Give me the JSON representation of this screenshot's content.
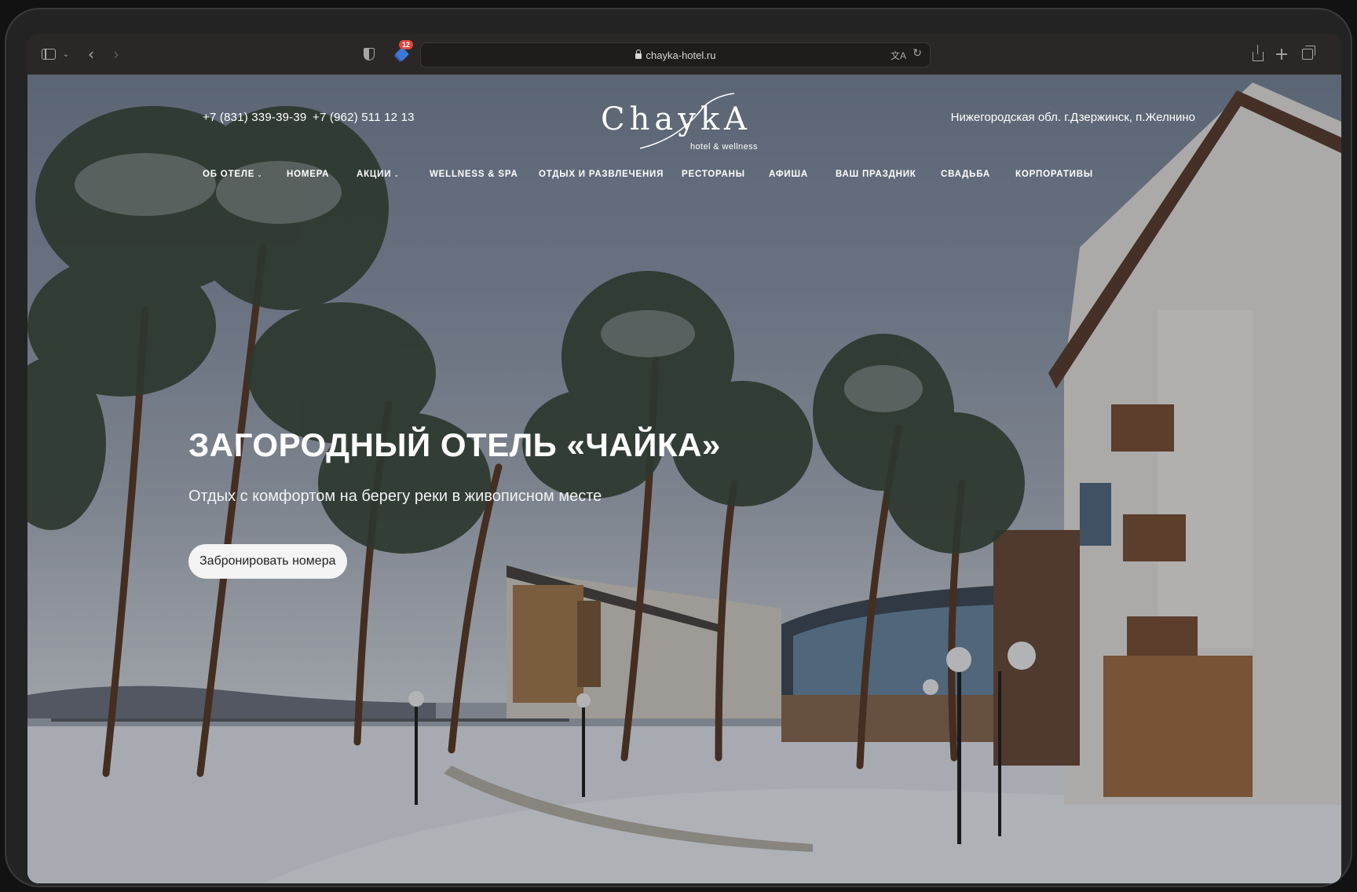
{
  "browser": {
    "url": "chayka-hotel.ru",
    "extension_badge": "12",
    "icons": [
      "sidebar-icon",
      "chevron-down-icon",
      "back-arrow-icon",
      "forward-arrow-icon",
      "shield-icon",
      "extension-icon",
      "lock-icon",
      "translate-icon",
      "reload-icon",
      "share-icon",
      "new-tab-plus-icon",
      "tabs-overview-icon"
    ]
  },
  "header": {
    "phone_1": "+7 (831) 339-39-39",
    "phone_2": "+7 (962) 511 12 13",
    "logo_text": "ChaykA",
    "logo_subtitle": "hotel & wellness",
    "address": "Нижегородская обл. г.Дзержинск, п.Желнино"
  },
  "nav": {
    "items": [
      {
        "label": "ОБ ОТЕЛЕ",
        "has_dropdown": true
      },
      {
        "label": "НОМЕРА",
        "has_dropdown": false
      },
      {
        "label": "АКЦИИ",
        "has_dropdown": true
      },
      {
        "label": "WELLNESS & SPA",
        "has_dropdown": false
      },
      {
        "label": "ОТДЫХ И РАЗВЛЕЧЕНИЯ",
        "has_dropdown": false
      },
      {
        "label": "РЕСТОРАНЫ",
        "has_dropdown": false
      },
      {
        "label": "АФИША",
        "has_dropdown": false
      },
      {
        "label": "ВАШ ПРАЗДНИК",
        "has_dropdown": false
      },
      {
        "label": "СВАДЬБА",
        "has_dropdown": false
      },
      {
        "label": "КОРПОРАТИВЫ",
        "has_dropdown": false
      }
    ]
  },
  "hero": {
    "title": "ЗАГОРОДНЫЙ ОТЕЛЬ «ЧАЙКА»",
    "subtitle": "Отдых с комфортом на берегу реки в живописном месте",
    "cta_label": "Забронировать номера"
  },
  "colors": {
    "sky_top": "#7a8799",
    "snow": "#e9ecf0",
    "cta_bg": "#f4f4f4",
    "text_light": "#ffffff"
  }
}
